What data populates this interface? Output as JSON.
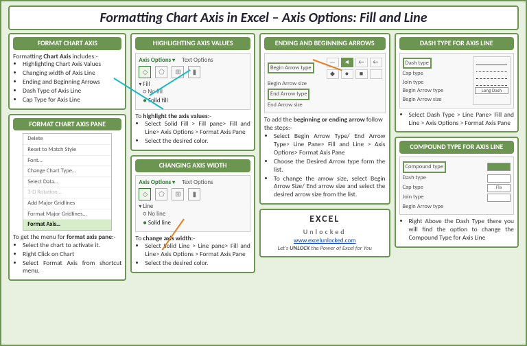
{
  "title": "Formatting Chart Axis in Excel – Axis Options: Fill and Line",
  "col1": {
    "card1": {
      "header": "FORMAT CHART AXIS",
      "intro": "Formatting Chart Axis includes:-",
      "items": [
        "Highlighting Chart Axis Values",
        "Changing width of Axis Line",
        "Ending and Beginning Arrows",
        "Dash Type of Axis Line",
        "Cap Type for Axis Line"
      ]
    },
    "card2": {
      "header": "FORMAT CHART AXIS PANE",
      "menu": [
        "Delete",
        "Reset to Match Style",
        "Font…",
        "Change Chart Type…",
        "Select Data…",
        "3-D Rotation…",
        "Add Major Gridlines",
        "Format Major Gridlines…",
        "Format Axis…"
      ],
      "intro": "To get the menu for format axis pane:-",
      "items": [
        "Select the chart to activate it.",
        "Right Click on Chart",
        "Select Format Axis from shortcut menu."
      ]
    }
  },
  "col2": {
    "card1": {
      "header": "HIGHLIGHTING AXIS VALUES",
      "tabs": {
        "a": "Axis Options",
        "b": "Text Options"
      },
      "section": "Fill",
      "radios": [
        "No fill",
        "Solid fill"
      ],
      "intro": "To highlight the axis values:-",
      "items": [
        "Select Solid Fill > Fill pane> Fill and Line> Axis Options > Format Axis Pane",
        "Select the desired color."
      ]
    },
    "card2": {
      "header": "CHANGING AXIS WIDTH",
      "section": "Line",
      "radios": [
        "No line",
        "Solid line"
      ],
      "intro": "To change axis width:-",
      "items": [
        "Select Solid Line > Line pane> Fill and Line> Axis Options > Format Axis Pane",
        "Select the desired color."
      ]
    }
  },
  "col3": {
    "card1": {
      "header": "ENDING AND BEGINNING ARROWS",
      "rows": [
        "Begin Arrow type",
        "Begin Arrow size",
        "End Arrow type",
        "End Arrow size"
      ],
      "intro": "To add the beginning or ending arrow follow the steps:-",
      "items": [
        "Select Begin Arrow Type/ End Arrow Type> Line Pane> Fill and Line > Axis Options> Format Axis Pane",
        "Choose the Desired Arrow type form the list.",
        "To change the arrow size, select Begin Arrow Size/ End arrow size and select the desired arrow size from the list."
      ]
    },
    "footer": {
      "logo1": "EXCEL",
      "logo2": "Unlocked",
      "url": "www.excelunlocked.com",
      "tag_pre": "Let's ",
      "tag_b": "UNLOCK",
      "tag_post": " the Power of Excel for You"
    }
  },
  "col4": {
    "card1": {
      "header": "DASH TYPE FOR AXIS LINE",
      "rows": [
        "Dash type",
        "Cap type",
        "Join type",
        "Begin Arrow type",
        "Begin Arrow size"
      ],
      "chip": "Long Dash",
      "items": [
        "Select Dash Type > Line Pane> Fill and Line > Axis Options > Format Axis Pane"
      ]
    },
    "card2": {
      "header": "COMPOUND TYPE FOR AXIS LINE",
      "rows": [
        "Compound type",
        "Dash type",
        "Cap type",
        "Join type",
        "Begin Arrow type"
      ],
      "flat": "Fla",
      "items": [
        "Right Above the Dash Type there you will find the option to change the Compound Type for Axis Line"
      ]
    }
  }
}
